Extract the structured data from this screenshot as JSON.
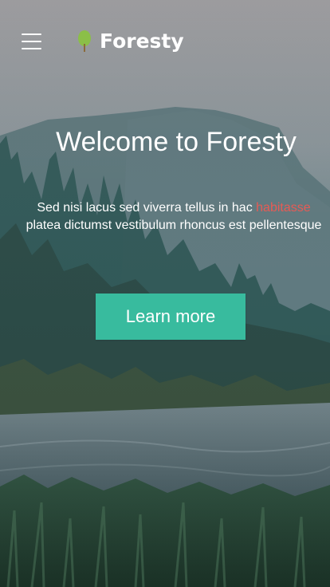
{
  "header": {
    "brand_name": "Foresty",
    "menu_icon": "hamburger-menu-icon",
    "logo_icon": "tree-icon"
  },
  "hero": {
    "title": "Welcome to Foresty",
    "text_part1": "Sed nisi lacus sed viverra tellus in hac ",
    "text_highlight": "habitasse",
    "text_part2": " platea dictumst vestibulum rhoncus est pellentesque",
    "button_label": "Learn more"
  },
  "colors": {
    "accent": "#38bb9e",
    "highlight": "#e65b55",
    "text": "#ffffff"
  }
}
